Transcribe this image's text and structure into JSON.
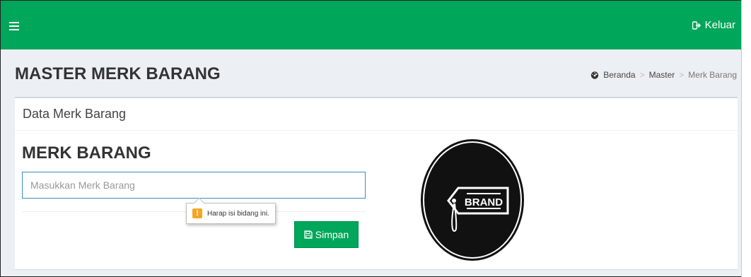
{
  "header": {
    "logout_label": "Keluar"
  },
  "content_header": {
    "title": "MASTER MERK BARANG",
    "breadcrumb": [
      "Beranda",
      "Master",
      "Merk Barang"
    ]
  },
  "box": {
    "header_title": "Data Merk Barang",
    "form_title": "MERK BARANG",
    "input": {
      "placeholder": "Masukkan Merk Barang",
      "value": ""
    },
    "validation_tooltip": "Harap isi bidang ini.",
    "save_label": "Simpan",
    "logo_text": "BRAND"
  },
  "colors": {
    "brand_green": "#00a65a",
    "input_focus": "#3c8dbc",
    "warning": "#f5a623"
  }
}
